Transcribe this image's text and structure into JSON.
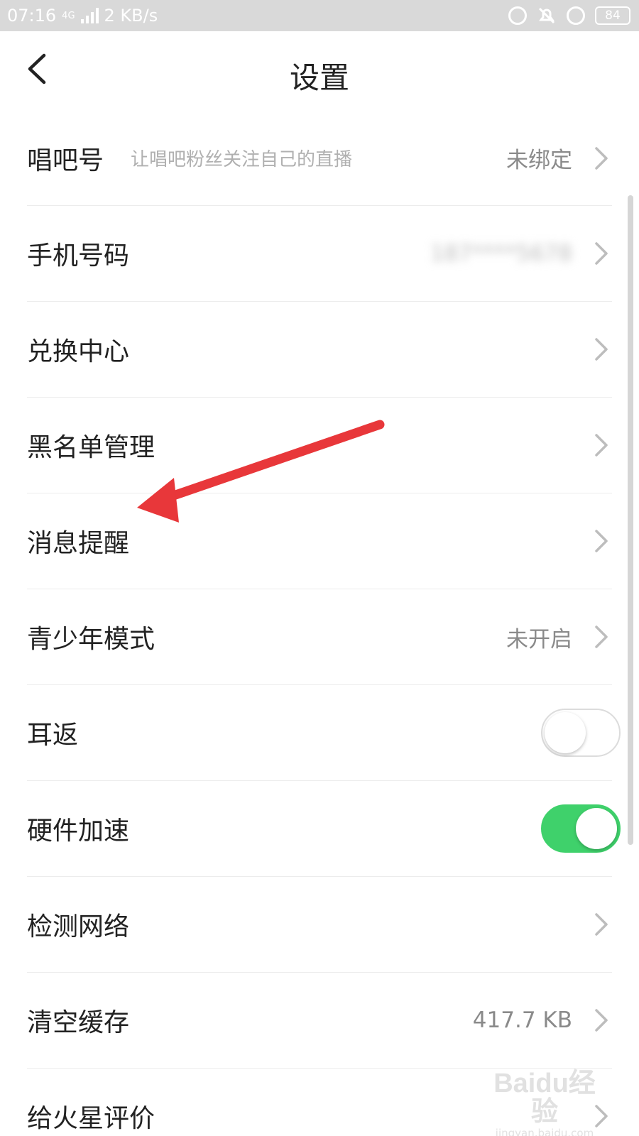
{
  "status_bar": {
    "time": "07:16",
    "network_type": "4G",
    "speed": "2 KB/s",
    "battery": "84"
  },
  "header": {
    "title": "设置"
  },
  "settings": [
    {
      "label": "唱吧号",
      "sub": "让唱吧粉丝关注自己的直播",
      "value": "未绑定",
      "control": "chevron"
    },
    {
      "label": "手机号码",
      "value": "187****5678",
      "control": "chevron",
      "blurred": true
    },
    {
      "label": "兑换中心",
      "control": "chevron"
    },
    {
      "label": "黑名单管理",
      "control": "chevron"
    },
    {
      "label": "消息提醒",
      "control": "chevron"
    },
    {
      "label": "青少年模式",
      "value": "未开启",
      "control": "chevron"
    },
    {
      "label": "耳返",
      "control": "toggle",
      "on": false
    },
    {
      "label": "硬件加速",
      "control": "toggle",
      "on": true
    },
    {
      "label": "检测网络",
      "control": "chevron"
    },
    {
      "label": "清空缓存",
      "value": "417.7 KB",
      "control": "chevron"
    },
    {
      "label": "给火星评价",
      "control": "chevron"
    }
  ],
  "colors": {
    "toggle_on": "#3fd16b",
    "annotation_arrow": "#e8373a",
    "value_text": "#8a8a8a"
  },
  "watermark": {
    "logo": "Baidu经验",
    "url": "jingyan.baidu.com"
  }
}
